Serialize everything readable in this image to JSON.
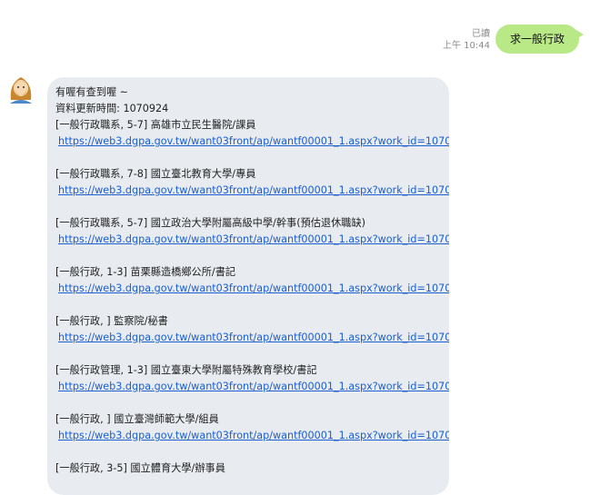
{
  "sent": {
    "read_label": "已讀",
    "time": "上午 10:44",
    "text": "求一般行政"
  },
  "received": {
    "greeting": "有喔有查到喔 ~",
    "update_line": "資料更新時間: 1070924",
    "jobs": [
      {
        "title": "[一般行政職系, 5-7] 高雄市立民生醫院/課員",
        "url": "https://web3.dgpa.gov.tw/want03front/ap/wantf00001_1.aspx?work_id=1070501599"
      },
      {
        "title": "[一般行政職系, 7-8] 國立臺北教育大學/專員",
        "url": "https://web3.dgpa.gov.tw/want03front/ap/wantf00001_1.aspx?work_id=1070502032"
      },
      {
        "title": "[一般行政職系, 5-7] 國立政治大學附屬高級中學/幹事(預估退休職缺)",
        "url": "https://web3.dgpa.gov.tw/want03front/ap/wantf00001_1.aspx?work_id=1070901726"
      },
      {
        "title": "[一般行政, 1-3] 苗栗縣造橋鄉公所/書記",
        "url": "https://web3.dgpa.gov.tw/want03front/ap/wantf00001_1.aspx?work_id=1070701804"
      },
      {
        "title": "[一般行政, ] 監察院/秘書",
        "url": "https://web3.dgpa.gov.tw/want03front/ap/wantf00001_1.aspx?work_id=1070801051"
      },
      {
        "title": "[一般行政管理, 1-3] 國立臺東大學附屬特殊教育學校/書記",
        "url": "https://web3.dgpa.gov.tw/want03front/ap/wantf00001_1.aspx?work_id=1070802738"
      },
      {
        "title": "[一般行政, ] 國立臺灣師範大學/組員",
        "url": "https://web3.dgpa.gov.tw/want03front/ap/wantf00001_1.aspx?work_id=1070900419"
      },
      {
        "title": "[一般行政, 3-5] 國立體育大學/辦事員",
        "url": ""
      }
    ]
  },
  "colors": {
    "sent_bubble": "#b8e986",
    "received_bubble": "#e8ecf1",
    "link": "#1a5fd0"
  }
}
